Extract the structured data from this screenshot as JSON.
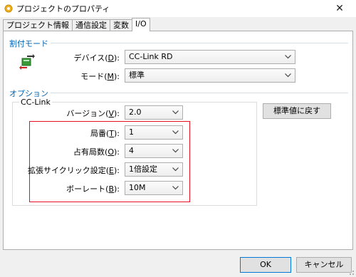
{
  "window": {
    "title": "プロジェクトのプロパティ",
    "close_glyph": "✕"
  },
  "tabs": [
    {
      "label": "プロジェクト情報",
      "active": false
    },
    {
      "label": "通信設定",
      "active": false
    },
    {
      "label": "変数",
      "active": false
    },
    {
      "label": "I/O",
      "active": true
    }
  ],
  "allocation_mode": {
    "section_label": "割付モード",
    "device_label": "デバイス(",
    "device_hotkey": "D",
    "device_label_end": "):",
    "device_value": "CC-Link RD",
    "mode_label": "モード(",
    "mode_hotkey": "M",
    "mode_label_end": "):",
    "mode_value": "標準"
  },
  "options": {
    "section_label": "オプション",
    "group_label": "CC-Link",
    "version_label": "バージョン(",
    "version_hotkey": "V",
    "version_label_end": "):",
    "version_value": "2.0",
    "station_label": "局番(",
    "station_hotkey": "T",
    "station_label_end": "):",
    "station_value": "1",
    "occupied_label": "占有局数(",
    "occupied_hotkey": "O",
    "occupied_label_end": "):",
    "occupied_value": "4",
    "extended_label": "拡張サイクリック設定(",
    "extended_hotkey": "E",
    "extended_label_end": "):",
    "extended_value": "1倍設定",
    "baud_label": "ボーレート(",
    "baud_hotkey": "B",
    "baud_label_end": "):",
    "baud_value": "10M",
    "reset_button": "標準値に戻す"
  },
  "footer": {
    "ok_button": "OK",
    "cancel_button": "キャンセル"
  },
  "colors": {
    "section_blue": "#0063b1",
    "highlight_red": "#e81123"
  },
  "icons": {
    "app": "gear-icon",
    "mode": "transfer-icon",
    "dropdown": "chevron-down-icon"
  }
}
